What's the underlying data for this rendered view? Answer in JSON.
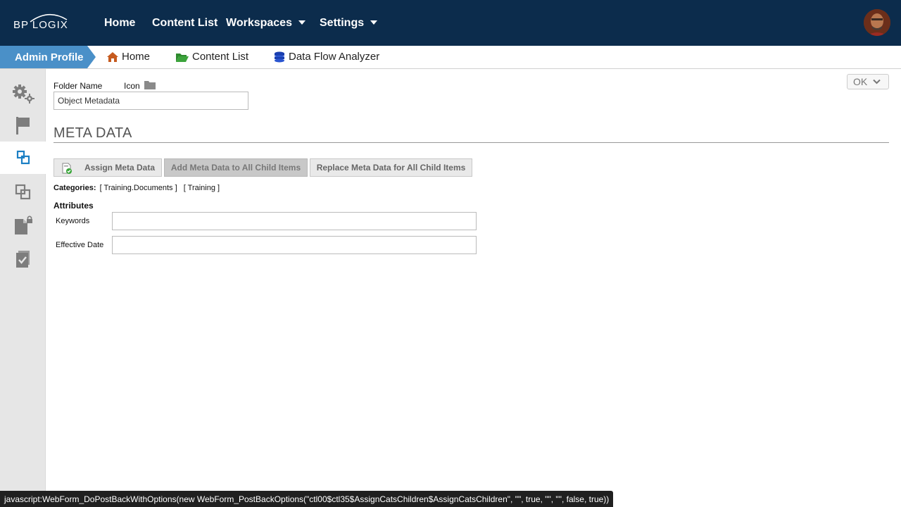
{
  "brand": {
    "name": "BP LOGIX"
  },
  "topnav": {
    "home": "Home",
    "content_list": "Content List",
    "workspaces": "Workspaces",
    "settings": "Settings"
  },
  "breadcrumb": {
    "admin_profile": "Admin Profile",
    "home": "Home",
    "content_list": "Content List",
    "data_flow_analyzer": "Data Flow Analyzer"
  },
  "form": {
    "folder_name_label": "Folder Name",
    "icon_label": "Icon",
    "folder_name_value": "Object Metadata",
    "ok_label": "OK"
  },
  "meta": {
    "title": "META DATA",
    "assign_btn": "Assign Meta Data",
    "add_children_btn": "Add Meta Data to All Child Items",
    "replace_children_btn": "Replace Meta Data for All Child Items",
    "categories_label": "Categories:",
    "categories": [
      "[ Training.Documents ]",
      "[ Training ]"
    ],
    "attributes_label": "Attributes",
    "keywords_label": "Keywords",
    "keywords_value": "",
    "effective_date_label": "Effective Date",
    "effective_date_value": ""
  },
  "status": {
    "text": "javascript:WebForm_DoPostBackWithOptions(new WebForm_PostBackOptions(\"ctl00$ctl35$AssignCatsChildren$AssignCatsChildren\", \"\", true, \"\", \"\", false, true))"
  },
  "colors": {
    "nav_bg": "#0c2c4c",
    "crumb_accent": "#4a90c8",
    "sidebar_bg": "#e6e6e6"
  }
}
